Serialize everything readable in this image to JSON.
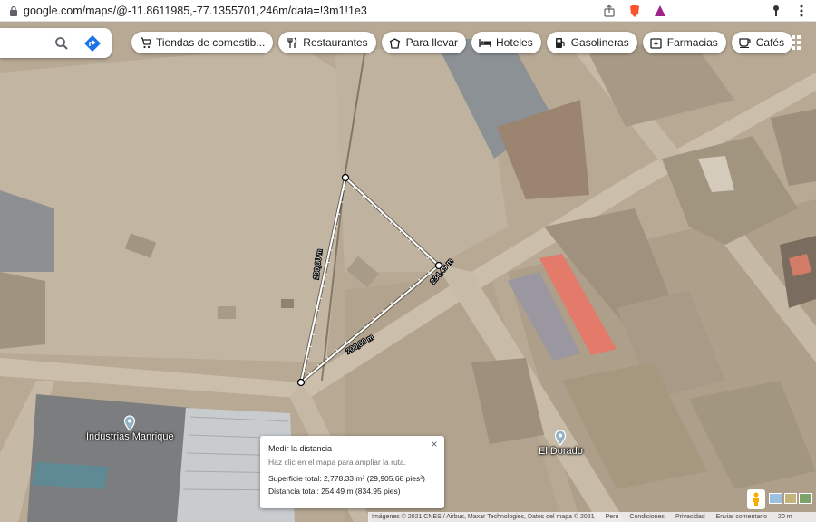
{
  "browser": {
    "url": "google.com/maps/@-11.8611985,-77.1355701,246m/data=!3m1!1e3"
  },
  "search": {
    "search_icon": "search-icon",
    "directions_icon": "directions-icon"
  },
  "chips": [
    {
      "label": "Tiendas de comestib...",
      "icon": "cart-icon"
    },
    {
      "label": "Restaurantes",
      "icon": "fork-knife-icon"
    },
    {
      "label": "Para llevar",
      "icon": "takeout-icon"
    },
    {
      "label": "Hoteles",
      "icon": "bed-icon"
    },
    {
      "label": "Gasolineras",
      "icon": "fuel-icon"
    },
    {
      "label": "Farmacias",
      "icon": "pharmacy-icon"
    },
    {
      "label": "Cafés",
      "icon": "coffee-icon"
    }
  ],
  "places": {
    "industrias": "Industrias Manrique",
    "eldorado": "El Dorado"
  },
  "measurement": {
    "segment_left": "100,00 m",
    "segment_right": "234,49 m",
    "segment_bottom": "200,00 m",
    "popup": {
      "title": "Medir la distancia",
      "hint": "Haz clic en el mapa para ampliar la ruta.",
      "area": "Superficie total: 2,778.33 m² (29,905.68 pies²)",
      "distance": "Distancia total: 254.49 m (834.95 pies)",
      "close": "×"
    }
  },
  "footer": {
    "imagery": "Imágenes © 2021 CNES / Airbus, Maxar Technologies, Datos del mapa © 2021",
    "country": "Perú",
    "terms": "Condiciones",
    "privacy": "Privacidad",
    "feedback": "Enviar comentario",
    "scale": "20 m"
  },
  "colors": {
    "ground": "#b8a996",
    "road": "#c9bca9",
    "roof_red": "#e57a6b",
    "roof_gray": "#8e9298",
    "measure_line": "#ffffff"
  }
}
